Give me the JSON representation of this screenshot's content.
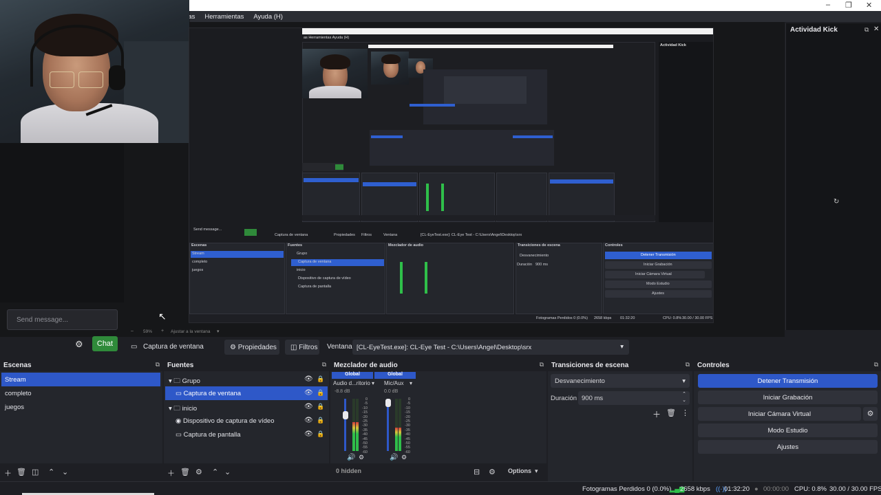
{
  "menu": {
    "items": [
      "nas",
      "Herramientas",
      "Ayuda (H)"
    ]
  },
  "kick": {
    "title": "Actividad Kick"
  },
  "chat": {
    "placeholder": "Send message...",
    "chat_button": "Chat"
  },
  "preview": {
    "zoom": "59%",
    "fit_label": "Ajustar a la ventana"
  },
  "source_toolbar": {
    "source_name": "Captura de ventana",
    "properties_label": "Propiedades",
    "filters_label": "Filtros",
    "window_label": "Ventana",
    "window_value": "[CL-EyeTest.exe]: CL-Eye Test - C:\\Users\\Angel\\Desktop\\srx"
  },
  "scenes": {
    "title": "Escenas",
    "items": [
      "Stream",
      "completo",
      "juegos"
    ],
    "selected_index": 0
  },
  "sources": {
    "title": "Fuentes",
    "items": [
      {
        "name": "Grupo",
        "type": "group"
      },
      {
        "name": "Captura de ventana",
        "type": "window"
      },
      {
        "name": "inicio",
        "type": "group"
      },
      {
        "name": "Dispositivo de captura de vídeo",
        "type": "camera"
      },
      {
        "name": "Captura de pantalla",
        "type": "display"
      }
    ],
    "selected_index": 1
  },
  "mixer": {
    "title": "Mezclador de audio",
    "channels": [
      {
        "header": "Global",
        "name": "Audio d...ritorio",
        "db": "-8.8 dB",
        "level": 0.55
      },
      {
        "header": "Global",
        "name": "Mic/Aux",
        "db": "0.0 dB",
        "level": 0.45
      }
    ],
    "scale": [
      "0",
      "-5",
      "-10",
      "-15",
      "-20",
      "-25",
      "-30",
      "-35",
      "-40",
      "-45",
      "-50",
      "-55",
      "-60"
    ],
    "hidden_label": "0 hidden",
    "options_label": "Options"
  },
  "transitions": {
    "title": "Transiciones de escena",
    "selected": "Desvanecimiento",
    "duration_label": "Duración",
    "duration_value": "900 ms"
  },
  "controls": {
    "title": "Controles",
    "buttons": [
      "Detener Transmisión",
      "Iniciar Grabación",
      "Iniciar Cámara Virtual",
      "Modo Estudio",
      "Ajustes"
    ]
  },
  "status": {
    "dropped_frames": "Fotogramas Perdidos 0 (0.0%)",
    "bitrate": "2658 kbps",
    "stream_time": "01:32:20",
    "rec_time": "00:00:00",
    "cpu": "CPU: 0.8%",
    "fps": "30.00 / 30.00 FPS"
  },
  "colors": {
    "accent": "#2e58c8",
    "chat_green": "#2f8a3a",
    "panel": "#24262c",
    "bg": "#1e1f24"
  }
}
